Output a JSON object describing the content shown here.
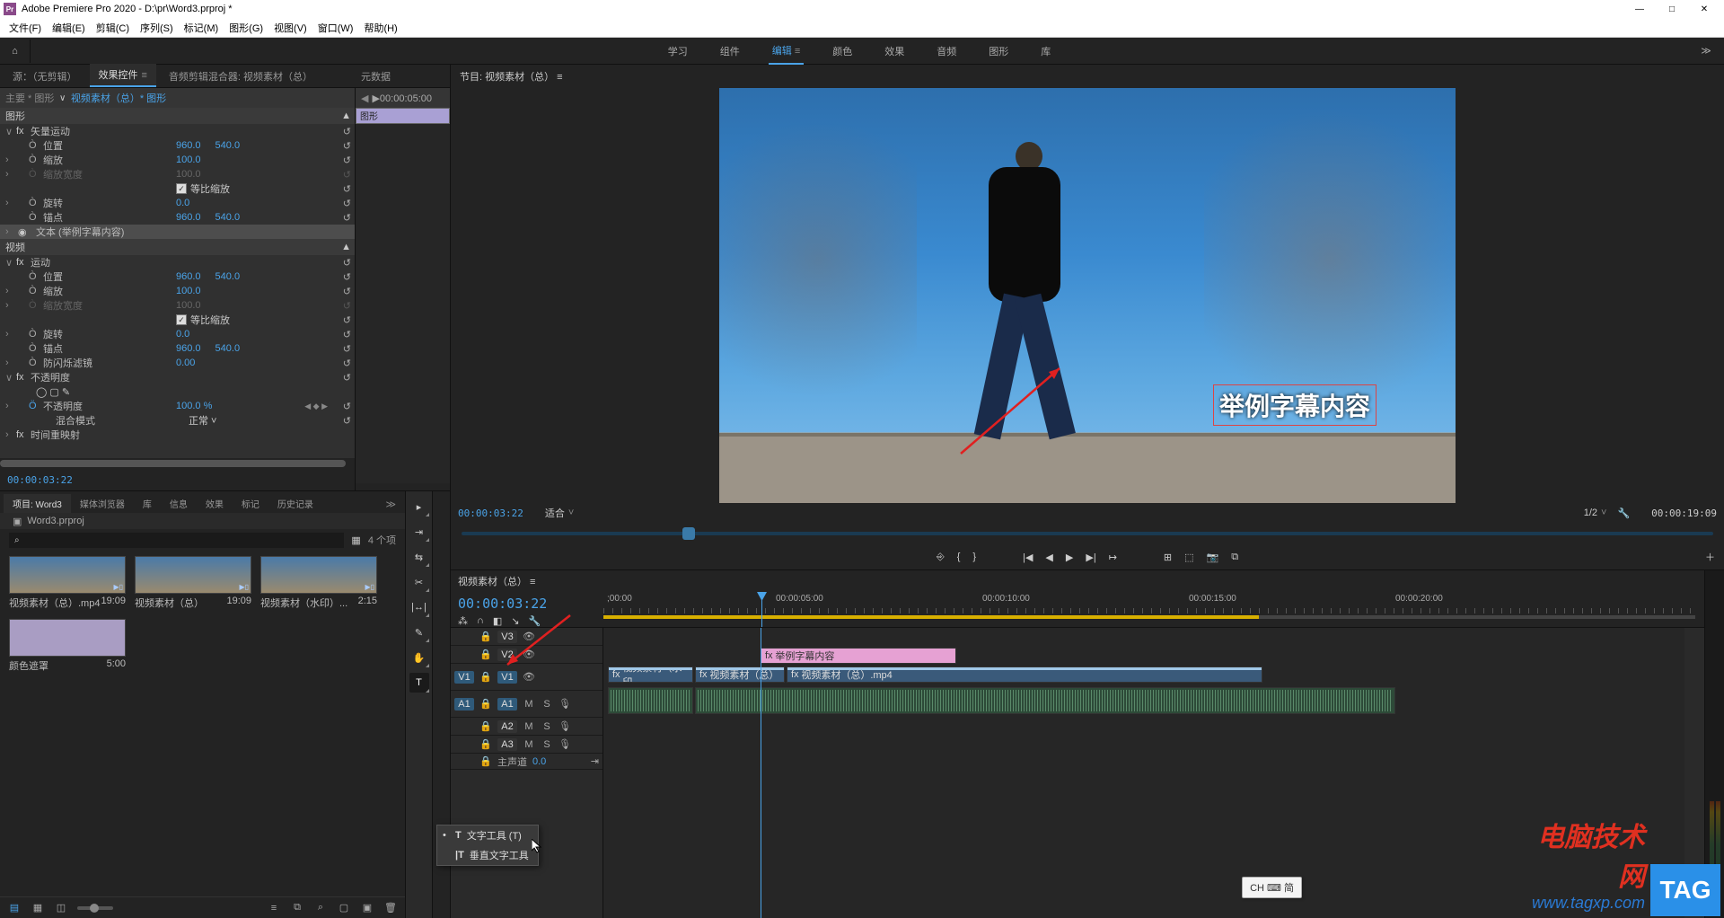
{
  "titlebar": {
    "app": "Adobe Premiere Pro 2020",
    "project_path": "D:\\pr\\Word3.prproj *"
  },
  "win": {
    "min": "—",
    "max": "□",
    "close": "✕"
  },
  "menu": [
    "文件(F)",
    "编辑(E)",
    "剪辑(C)",
    "序列(S)",
    "标记(M)",
    "图形(G)",
    "视图(V)",
    "窗口(W)",
    "帮助(H)"
  ],
  "workspace": [
    "学习",
    "组件",
    "编辑",
    "颜色",
    "效果",
    "音频",
    "图形",
    "库"
  ],
  "workspace_active": "编辑",
  "source_tabs": {
    "source": "源：（无剪辑）",
    "effect_controls": "效果控件",
    "audio_mixer": "音频剪辑混合器: 视频素材（总）",
    "metadata": "元数据"
  },
  "ec": {
    "crumb1": "主要 * 图形",
    "crumb2": "视频素材（总）* 图形",
    "graphic_head": "图形",
    "vector_motion": "矢量运动",
    "position": "位置",
    "pos_x": "960.0",
    "pos_y": "540.0",
    "scale": "缩放",
    "scale_v": "100.0",
    "scale_w": "缩放宽度",
    "scale_w_v": "100.0",
    "uniform": "等比缩放",
    "rotation": "旋转",
    "rot_v": "0.0",
    "anchor": "锚点",
    "anc_x": "960.0",
    "anc_y": "540.0",
    "text_layer": "文本 (举例字幕内容)",
    "video_head": "视频",
    "motion": "运动",
    "anti_flicker": "防闪烁滤镜",
    "af_v": "0.00",
    "opacity": "不透明度",
    "opacity_v": "100.0 %",
    "blend": "混合模式",
    "blend_v": "正常",
    "time_remap": "时间重映射",
    "tc": "00:00:03:22",
    "ruler_start": "▶00:00:05:00",
    "clip": "图形"
  },
  "program": {
    "title": "节目: 视频素材（总）",
    "caption": "举例字幕内容",
    "tc_left": "00:00:03:22",
    "fit": "适合",
    "zoom": "1/2",
    "tc_right": "00:00:19:09"
  },
  "transport_icons": [
    "⎆",
    "{",
    "}",
    "|◀",
    "◀",
    "▶",
    "▶|",
    "↦",
    "⊞",
    "⬚",
    "📷",
    "⧉"
  ],
  "project": {
    "tabs": [
      "项目: Word3",
      "媒体浏览器",
      "库",
      "信息",
      "效果",
      "标记",
      "历史记录"
    ],
    "name": "Word3.prproj",
    "count": "4 个项",
    "items": [
      {
        "label": "视频素材（总）.mp4",
        "dur": "19:09"
      },
      {
        "label": "视频素材（总）",
        "dur": "19:09"
      },
      {
        "label": "视频素材（水印）...",
        "dur": "2:15"
      },
      {
        "label": "颜色遮罩",
        "dur": "5:00"
      }
    ]
  },
  "tools_flyout": [
    {
      "icon": "T",
      "label": "文字工具 (T)",
      "active": true
    },
    {
      "icon": "|T",
      "label": "垂直文字工具",
      "active": false
    }
  ],
  "timeline": {
    "title": "视频素材（总）",
    "tc": "00:00:03:22",
    "ruler": [
      ";00:00",
      "00:00:05:00",
      "00:00:10:00",
      "00:00:15:00",
      "00:00:20:00"
    ],
    "track_v3": "V3",
    "track_v2": "V2",
    "track_v1": "V1",
    "track_a1": "A1",
    "track_a2": "A2",
    "track_a3": "A3",
    "master": "主声道",
    "db": "0.0",
    "graphic_clip": "举例字幕内容",
    "vid1": "视频素材（水印",
    "vid2": "视频素材（总）",
    "vid3": "视频素材（总）.mp4"
  },
  "ime": "CH ⌨ 简",
  "watermark": {
    "l1": "电脑技术网",
    "l2": "www.tagxp.com",
    "tag": "TAG"
  }
}
